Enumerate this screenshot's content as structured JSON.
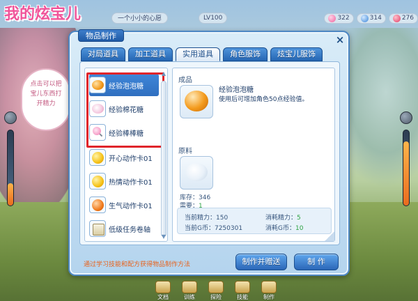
{
  "game": {
    "logo": "我的炫宝儿"
  },
  "hud": {
    "player_name": "一个小小的心愿",
    "level": "LV100",
    "currency_pink": "322",
    "currency_blue": "314",
    "hearts": "276"
  },
  "npc": {
    "bubble_text": "点击可以把宝儿东西打开精力"
  },
  "bottom_bar": {
    "items": [
      "文档",
      "训练",
      "探险",
      "技能",
      "制作"
    ]
  },
  "dialog": {
    "title": "物品制作",
    "close": "×",
    "tabs": [
      {
        "label": "对局道具",
        "active": false
      },
      {
        "label": "加工道具",
        "active": false
      },
      {
        "label": "实用道具",
        "active": true
      },
      {
        "label": "角色服饰",
        "active": false
      },
      {
        "label": "炫宝儿服饰",
        "active": false
      }
    ],
    "recipes": [
      {
        "name": "经验泡泡糖",
        "icon": "orange-candy-icon",
        "selected": true
      },
      {
        "name": "经验棉花糖",
        "icon": "cotton-candy-icon",
        "selected": false
      },
      {
        "name": "经验棒棒糖",
        "icon": "lollipop-icon",
        "selected": false
      },
      {
        "name": "开心动作卡01",
        "icon": "happy-face-icon",
        "selected": false
      },
      {
        "name": "热情动作卡01",
        "icon": "passion-face-icon",
        "selected": false
      },
      {
        "name": "生气动作卡01",
        "icon": "angry-face-icon",
        "selected": false
      },
      {
        "name": "低级任务卷轴",
        "icon": "scroll-icon",
        "selected": false
      }
    ],
    "detail": {
      "product_label": "成品",
      "product_name": "经验泡泡糖",
      "product_desc": "使用后可增加角色50点经验值。",
      "material_label": "原料",
      "stock_label": "库存：",
      "stock_value": "346",
      "need_label": "需要：",
      "need_value": "1",
      "current_energy_label": "当前精力：",
      "current_energy_value": "150",
      "cost_energy_label": "消耗精力：",
      "cost_energy_value": "5",
      "current_gold_label": "当前G币：",
      "current_gold_value": "7250301",
      "cost_gold_label": "消耗G币：",
      "cost_gold_value": "10"
    },
    "tip": "通过学习技能和配方获得物品制作方法",
    "make_gift_button": "制作并赠送",
    "make_button": "制  作"
  }
}
